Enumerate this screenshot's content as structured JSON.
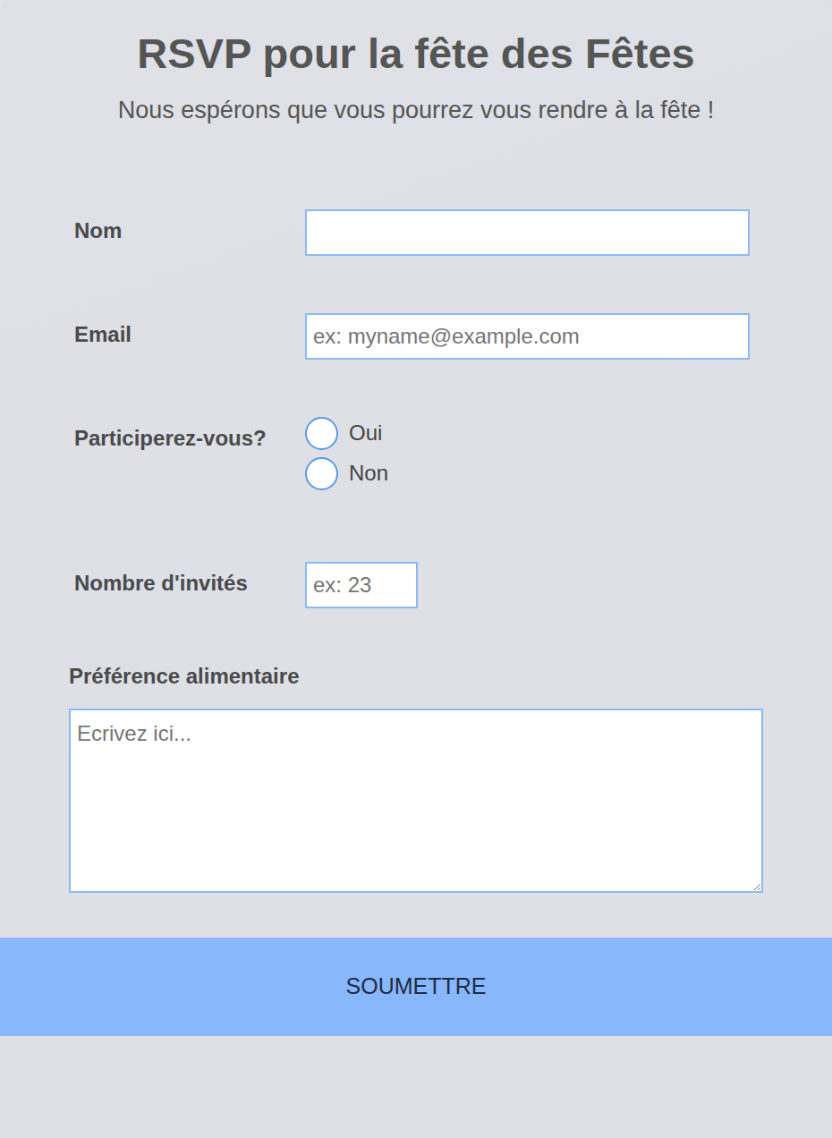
{
  "title": "RSVP pour la fête des Fêtes",
  "subtitle": "Nous espérons que vous pourrez vous rendre à la fête !",
  "form": {
    "fields": [
      {
        "kind": "text",
        "label": "Nom"
      },
      {
        "kind": "email",
        "label": "Email",
        "placeholder": "ex: myname@example.com"
      },
      {
        "kind": "radio",
        "label": "Participerez-vous?",
        "options": [
          {
            "label": "Oui",
            "selected": false
          },
          {
            "label": "Non",
            "selected": false
          }
        ]
      },
      {
        "kind": "number",
        "label": "Nombre d'invités",
        "placeholder": "ex: 23"
      },
      {
        "kind": "textarea",
        "label": "Préférence alimentaire",
        "placeholder": "Ecrivez ici..."
      }
    ]
  },
  "buttons": [
    "SOUMETTRE"
  ]
}
